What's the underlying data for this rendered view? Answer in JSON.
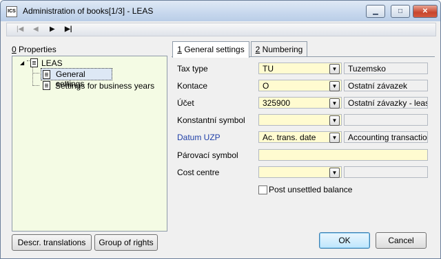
{
  "window": {
    "app_icon_text": "ICS",
    "title": "Administration of books[1/3] - LEAS",
    "minimize_icon": "minimize-icon",
    "maximize_icon": "maximize-icon",
    "close_icon": "close-icon"
  },
  "toolbar": {
    "first": "|◀",
    "prev": "◀",
    "next": "▶",
    "last": "▶|"
  },
  "properties": {
    "label_key": "0",
    "label_rest": " Properties",
    "tree": {
      "root": "LEAS",
      "children": [
        "General settings",
        "Settings for business years"
      ]
    }
  },
  "bottom_left_buttons": {
    "descr": "Descr. translations",
    "rights": "Group of rights"
  },
  "tabs": [
    {
      "key": "1",
      "label": " General settings"
    },
    {
      "key": "2",
      "label": " Numbering"
    }
  ],
  "form": {
    "tax_type": {
      "label": "Tax type",
      "value": "TU",
      "desc": "Tuzemsko"
    },
    "kontace": {
      "label": "Kontace",
      "value": "O",
      "desc": "Ostatní závazek"
    },
    "ucet": {
      "label": "Účet",
      "value": "325900",
      "desc": "Ostatní závazky - leasin"
    },
    "konstantni": {
      "label": "Konstantní symbol",
      "value": "",
      "desc": ""
    },
    "datum_uzp": {
      "label": "Datum UZP",
      "value": "Ac. trans. date",
      "desc": "Accounting transaction"
    },
    "parovaci": {
      "label": "Párovací symbol",
      "value": ""
    },
    "cost_centre": {
      "label": "Cost centre",
      "value": "",
      "desc": ""
    },
    "post_unsettled": {
      "label": "Post unsettled balance",
      "checked": false
    }
  },
  "dialog_buttons": {
    "ok": "OK",
    "cancel": "Cancel"
  },
  "colors": {
    "field_bg": "#fffbd0",
    "tree_bg": "#f4fbe4",
    "link_label": "#1f3fa8"
  }
}
